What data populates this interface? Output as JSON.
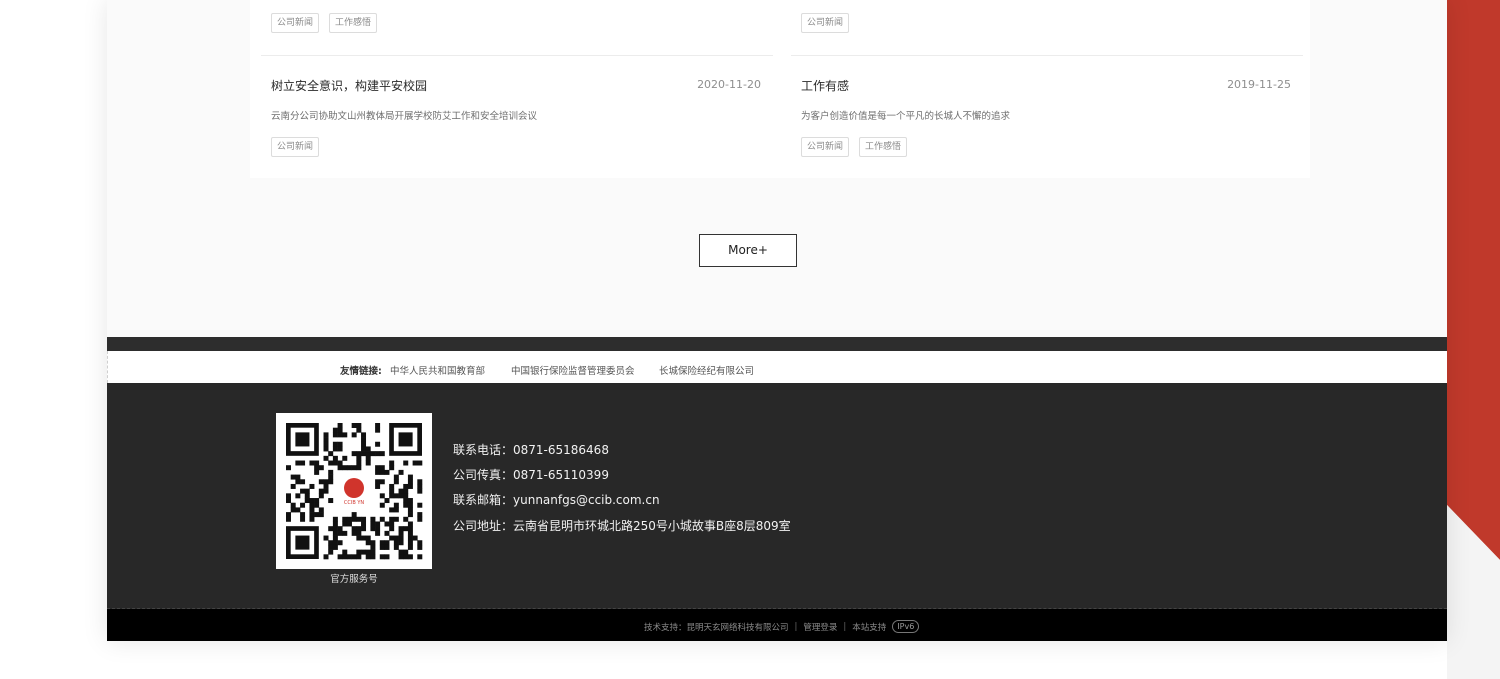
{
  "colors": {
    "accent_red": "#c0392b",
    "footer_dark": "#282828",
    "footer_black": "#000000"
  },
  "news": {
    "top_row": [
      {
        "tags": [
          "公司新闻",
          "工作感悟"
        ]
      },
      {
        "tags": [
          "公司新闻"
        ]
      }
    ],
    "items": [
      {
        "title": "树立安全意识，构建平安校园",
        "date": "2020-11-20",
        "desc": "云南分公司协助文山州教体局开展学校防艾工作和安全培训会议",
        "tags": [
          "公司新闻"
        ]
      },
      {
        "title": "工作有感",
        "date": "2019-11-25",
        "desc": "为客户创造价值是每一个平凡的长城人不懈的追求",
        "tags": [
          "公司新闻",
          "工作感悟"
        ]
      }
    ]
  },
  "more_button": "More+",
  "links": {
    "label": "友情链接:",
    "items": [
      "中华人民共和国教育部",
      "中国银行保险监督管理委员会",
      "长城保险经纪有限公司"
    ]
  },
  "contact": {
    "qr_caption": "官方服务号",
    "qr_logo_text": "CCIB YN",
    "phone": "联系电话：0871-65186468",
    "fax": "公司传真：0871-65110399",
    "email": "联系邮箱：yunnanfgs@ccib.com.cn",
    "address": "公司地址：云南省昆明市环城北路250号小城故事B座8层809室"
  },
  "bottom": {
    "tech_support": "技术支持：昆明天玄网络科技有限公司",
    "admin_login": "管理登录",
    "site_support": "本站支持",
    "ipv6": "IPv6"
  }
}
